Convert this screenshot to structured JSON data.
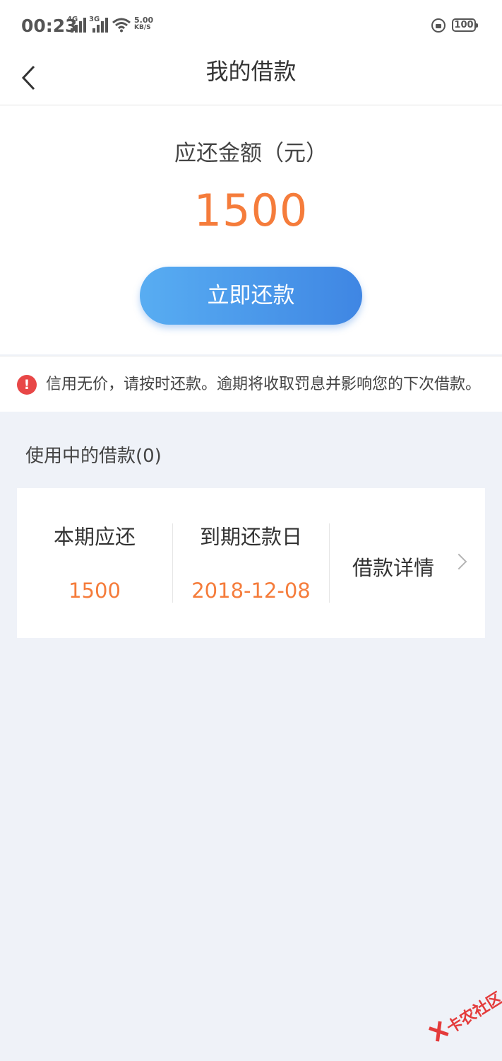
{
  "status_bar": {
    "time": "00:23",
    "signal1": "4G",
    "signal2": "3G",
    "net_speed_value": "5.00",
    "net_speed_unit": "KB/S",
    "battery": "100"
  },
  "nav": {
    "title": "我的借款"
  },
  "summary": {
    "amount_label": "应还金额（元）",
    "amount_value": "1500",
    "repay_button": "立即还款"
  },
  "notice": {
    "icon": "!",
    "text": "信用无价，请按时还款。逾期将收取罚息并影响您的下次借款。"
  },
  "section": {
    "title": "使用中的借款(0)"
  },
  "loan": {
    "current_due_label": "本期应还",
    "current_due_value": "1500",
    "due_date_label": "到期还款日",
    "due_date_value": "2018-12-08",
    "detail_label": "借款详情"
  },
  "watermark": {
    "text": "卡农社区"
  },
  "colors": {
    "accent_orange": "#f57c3b",
    "button_blue_start": "#58adf2",
    "button_blue_end": "#3f86e3",
    "alert_red": "#e84747",
    "page_bg": "#eff2f8"
  }
}
